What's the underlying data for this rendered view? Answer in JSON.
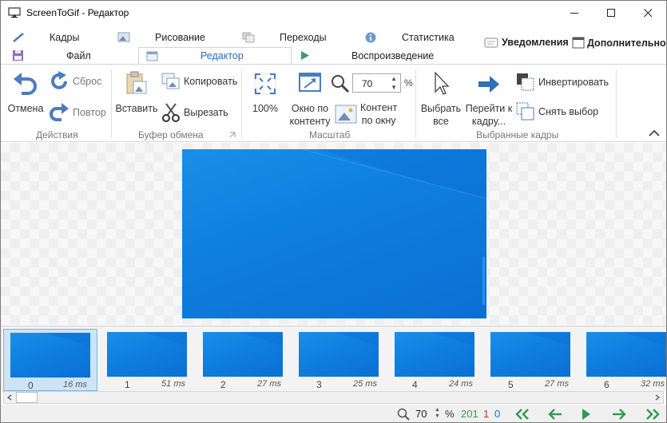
{
  "window": {
    "title": "ScreenToGif - Редактор"
  },
  "tabs": {
    "row1": [
      {
        "label": "Кадры",
        "icon": "pencil-icon"
      },
      {
        "label": "Рисование",
        "icon": "image-icon"
      },
      {
        "label": "Переходы",
        "icon": "transitions-icon"
      },
      {
        "label": "Статистика",
        "icon": "info-icon"
      }
    ],
    "row2": [
      {
        "label": "Файл",
        "icon": "save-icon"
      },
      {
        "label": "Редактор",
        "icon": "editor-icon",
        "active": true
      },
      {
        "label": "Воспроизведение",
        "icon": "play-icon"
      }
    ],
    "notifications": "Уведомления",
    "extras": "Дополнительно"
  },
  "ribbon": {
    "actions": {
      "undo": "Отмена",
      "reset": "Сброс",
      "redo": "Повтор",
      "group": "Действия"
    },
    "clipboard": {
      "paste": "Вставить",
      "copy": "Копировать",
      "cut": "Вырезать",
      "group": "Буфер обмена"
    },
    "zoom": {
      "fit100": "100%",
      "window_line1": "Окно по",
      "window_line2": "контенту",
      "content_line1": "Контент",
      "content_line2": "по окну",
      "value": "70",
      "unit": "%",
      "group": "Масштаб"
    },
    "selection": {
      "select_all_line1": "Выбрать",
      "select_all_line2": "все",
      "goto_line1": "Перейти к",
      "goto_line2": "кадру...",
      "invert": "Инвертировать",
      "deselect": "Снять выбор",
      "group": "Выбранные кадры"
    }
  },
  "frames": [
    {
      "index": "0",
      "delay": "16 ms",
      "selected": true
    },
    {
      "index": "1",
      "delay": "51 ms"
    },
    {
      "index": "2",
      "delay": "27 ms"
    },
    {
      "index": "3",
      "delay": "25 ms"
    },
    {
      "index": "4",
      "delay": "24 ms"
    },
    {
      "index": "5",
      "delay": "27 ms"
    },
    {
      "index": "6",
      "delay": "32 ms"
    }
  ],
  "status": {
    "zoom": "70",
    "zoom_unit": "%",
    "total_frames": "201",
    "selected_frames": "1",
    "current_frame": "0"
  },
  "colors": {
    "accent": "#2a6fb5",
    "desktop_blue": "#0f7fdf",
    "green": "#2e9b4f",
    "red": "#c0392b",
    "blue_count": "#1a6fc4"
  }
}
